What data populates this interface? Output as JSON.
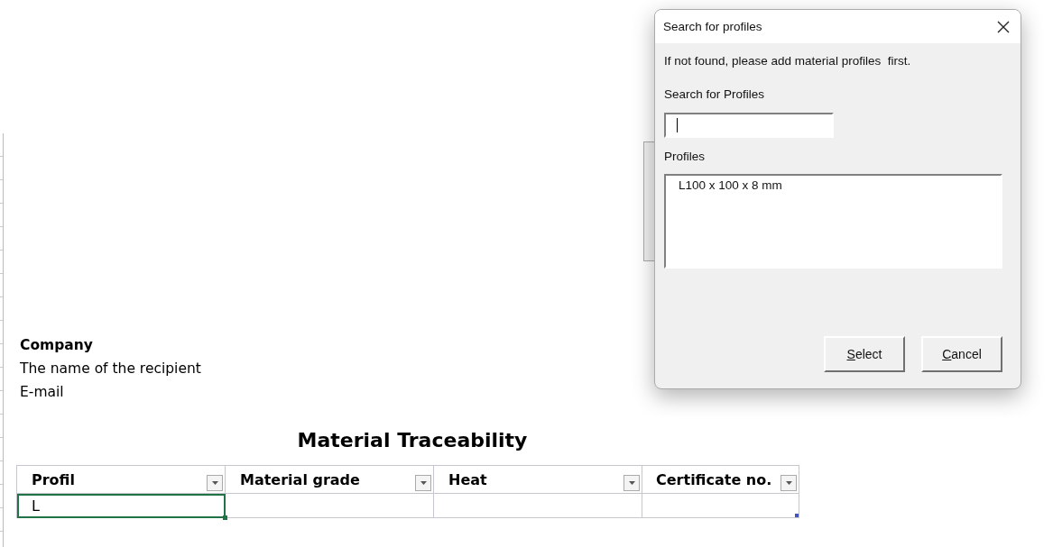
{
  "sheet": {
    "header_block": [
      {
        "text": "Company",
        "bold": true
      },
      {
        "text": "The name of the recipient",
        "bold": false
      },
      {
        "text": "E-mail",
        "bold": false
      }
    ],
    "title": "Material Traceability",
    "table": {
      "columns": [
        {
          "label": "Profil",
          "filter": true
        },
        {
          "label": "Material grade",
          "filter": true
        },
        {
          "label": "Heat",
          "filter": true
        },
        {
          "label": "Certificate no.",
          "filter": true
        }
      ],
      "rows": [
        {
          "cells": [
            {
              "text": "L",
              "selected": true
            },
            {
              "selected": false
            },
            {
              "selected": false
            },
            {
              "selected": false
            }
          ]
        }
      ]
    }
  },
  "dialog": {
    "title": "Search for profiles",
    "message": "If not found, please add material profiles  first.",
    "search_label": "Search for Profiles",
    "search_field": {
      "focused": true
    },
    "profiles_label": "Profiles",
    "profiles": [
      {
        "text": "L100 x 100 x 8 mm",
        "selected": false
      }
    ],
    "buttons": [
      {
        "label": "Select",
        "mnemonic_underlined": true
      },
      {
        "label": "Cancel",
        "mnemonic_underlined": true
      }
    ]
  }
}
